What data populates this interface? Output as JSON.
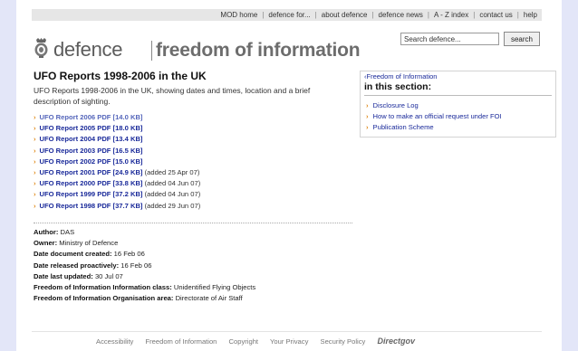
{
  "topnav": [
    "MOD home",
    "defence for...",
    "about defence",
    "defence news",
    "A - Z index",
    "contact us",
    "help"
  ],
  "search": {
    "value": "Search defence...",
    "button_label": "search"
  },
  "brand": {
    "defence": "defence",
    "foi": "freedom of information"
  },
  "main": {
    "title": "UFO Reports 1998-2006 in the UK",
    "intro": "UFO Reports 1998-2006 in the UK, showing dates and times, location and a brief description of sighting.",
    "reports": [
      {
        "label": "UFO Report 2006 PDF [14.0 KB]",
        "added": ""
      },
      {
        "label": "UFO Report 2005 PDF [18.0 KB]",
        "added": ""
      },
      {
        "label": "UFO Report 2004 PDF [13.4 KB]",
        "added": ""
      },
      {
        "label": "UFO Report 2003 PDF [16.5 KB]",
        "added": ""
      },
      {
        "label": "UFO Report 2002 PDF [15.0 KB]",
        "added": ""
      },
      {
        "label": "UFO Report 2001 PDF [24.9 KB]",
        "added": "(added 25 Apr 07)"
      },
      {
        "label": "UFO Report 2000 PDF [33.8 KB]",
        "added": "(added 04 Jun 07)"
      },
      {
        "label": "UFO Report 1999 PDF [37.2 KB]",
        "added": "(added 04 Jun 07)"
      },
      {
        "label": "UFO Report 1998 PDF [37.7 KB]",
        "added": "(added 29 Jun 07)"
      }
    ],
    "meta": [
      {
        "key": "Author:",
        "value": "DAS"
      },
      {
        "key": "Owner:",
        "value": "Ministry of Defence"
      },
      {
        "key": "Date document created:",
        "value": "16 Feb 06"
      },
      {
        "key": "Date released proactively:",
        "value": "16 Feb 06"
      },
      {
        "key": "Date last updated:",
        "value": "30 Jul 07"
      },
      {
        "key": "Freedom of Information Information class:",
        "value": "Unidentified Flying Objects"
      },
      {
        "key": "Freedom of Information Organisation area:",
        "value": "Directorate of Air Staff"
      }
    ]
  },
  "sidebar": {
    "crumb": "Freedom of Information",
    "heading": "in this section:",
    "links": [
      "Disclosure Log",
      "How to make an official request under FOI",
      "Publication Scheme"
    ]
  },
  "footer": {
    "links": [
      "Accessibility",
      "Freedom of Information",
      "Copyright",
      "Your Privacy",
      "Security Policy"
    ],
    "logo": "Directgov"
  }
}
